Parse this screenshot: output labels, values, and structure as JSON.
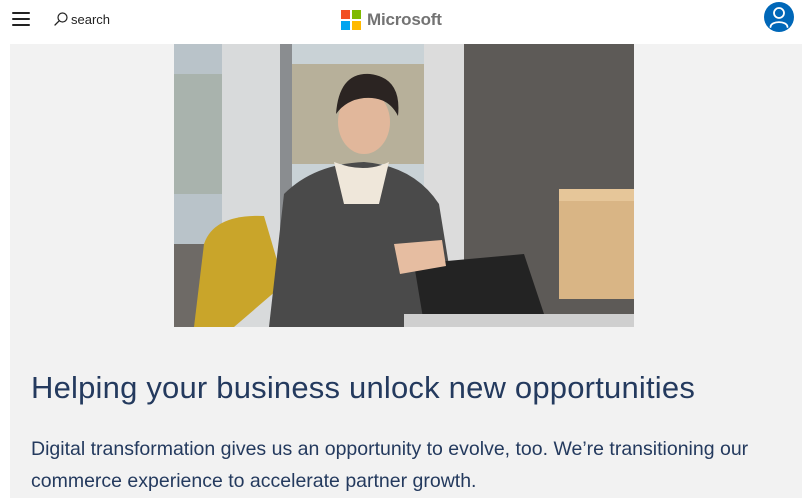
{
  "header": {
    "menu_icon": "hamburger-menu-icon",
    "search_label": "search",
    "search_icon": "search-icon",
    "brand_name": "Microsoft",
    "logo_colors": [
      "#f25022",
      "#7fba00",
      "#00a4ef",
      "#ffb900"
    ],
    "account_icon": "account-avatar-icon",
    "account_color": "#0067b8"
  },
  "hero": {
    "image": "photo-woman-working-on-laptop-in-office"
  },
  "content": {
    "headline": "Helping your business unlock new opportunities",
    "body": "Digital transformation gives us an opportunity to evolve, too. We’re transitioning our commerce experience to accelerate partner growth."
  },
  "colors": {
    "text": "#243a5e",
    "panel_bg": "#f2f2f2"
  }
}
